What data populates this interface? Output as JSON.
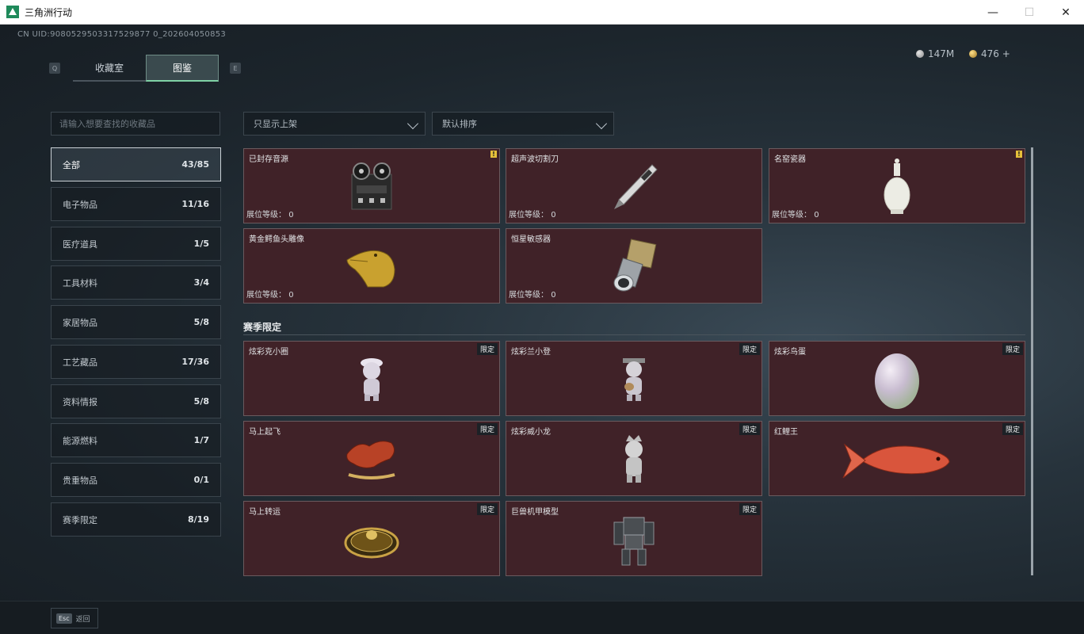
{
  "window": {
    "title": "三角洲行动",
    "minimize": "—",
    "maximize": "☐",
    "close": "✕"
  },
  "header": {
    "uid": "CN UID:9080529503317529877 0_202604050853",
    "tab_left_key": "Q",
    "tab_right_key": "E",
    "tabs": [
      {
        "label": "收藏室",
        "active": false
      },
      {
        "label": "图鉴",
        "active": true
      }
    ],
    "currency": [
      {
        "icon": "silver-coin-icon",
        "value": "147M"
      },
      {
        "icon": "gold-coin-icon",
        "value": "476 +"
      }
    ]
  },
  "sidebar": {
    "search_placeholder": "请输入想要查找的收藏品",
    "categories": [
      {
        "label": "全部",
        "count": "43/85",
        "active": true
      },
      {
        "label": "电子物品",
        "count": "11/16"
      },
      {
        "label": "医疗道具",
        "count": "1/5"
      },
      {
        "label": "工具材料",
        "count": "3/4"
      },
      {
        "label": "家居物品",
        "count": "5/8"
      },
      {
        "label": "工艺藏品",
        "count": "17/36"
      },
      {
        "label": "资料情报",
        "count": "5/8"
      },
      {
        "label": "能源燃料",
        "count": "1/7"
      },
      {
        "label": "贵重物品",
        "count": "0/1"
      },
      {
        "label": "赛季限定",
        "count": "8/19"
      }
    ]
  },
  "filters": {
    "shelf_filter": "只显示上架",
    "sort": "默认排序"
  },
  "level_label": "展位等级：",
  "limited_label": "限定",
  "items": [
    {
      "name": "已封存音源",
      "level": "0",
      "warn": "!",
      "icon": "reel-recorder-icon"
    },
    {
      "name": "超声波切割刀",
      "level": "0",
      "icon": "cutter-pen-icon"
    },
    {
      "name": "名窑瓷器",
      "level": "0",
      "warn": "!",
      "icon": "porcelain-vase-icon"
    },
    {
      "name": "黄金鳄鱼头雕像",
      "level": "0",
      "icon": "gold-crocodile-icon"
    },
    {
      "name": "恒星敏感器",
      "level": "0",
      "icon": "star-sensor-icon"
    }
  ],
  "season_section": {
    "title": "赛季限定",
    "items": [
      {
        "name": "炫彩克小圈",
        "icon": "figurine-icon"
      },
      {
        "name": "炫彩兰小登",
        "icon": "figurine-guitar-icon"
      },
      {
        "name": "炫彩鸟蛋",
        "icon": "egg-icon"
      },
      {
        "name": "马上起飞",
        "icon": "red-horse-icon"
      },
      {
        "name": "炫彩威小龙",
        "icon": "figurine-crown-icon"
      },
      {
        "name": "红鲤王",
        "icon": "koi-fish-icon"
      },
      {
        "name": "马上转运",
        "icon": "gold-disc-icon"
      },
      {
        "name": "巨兽机甲模型",
        "icon": "mech-model-icon"
      }
    ]
  },
  "footer": {
    "esc_key": "Esc",
    "back_label": "返回"
  }
}
